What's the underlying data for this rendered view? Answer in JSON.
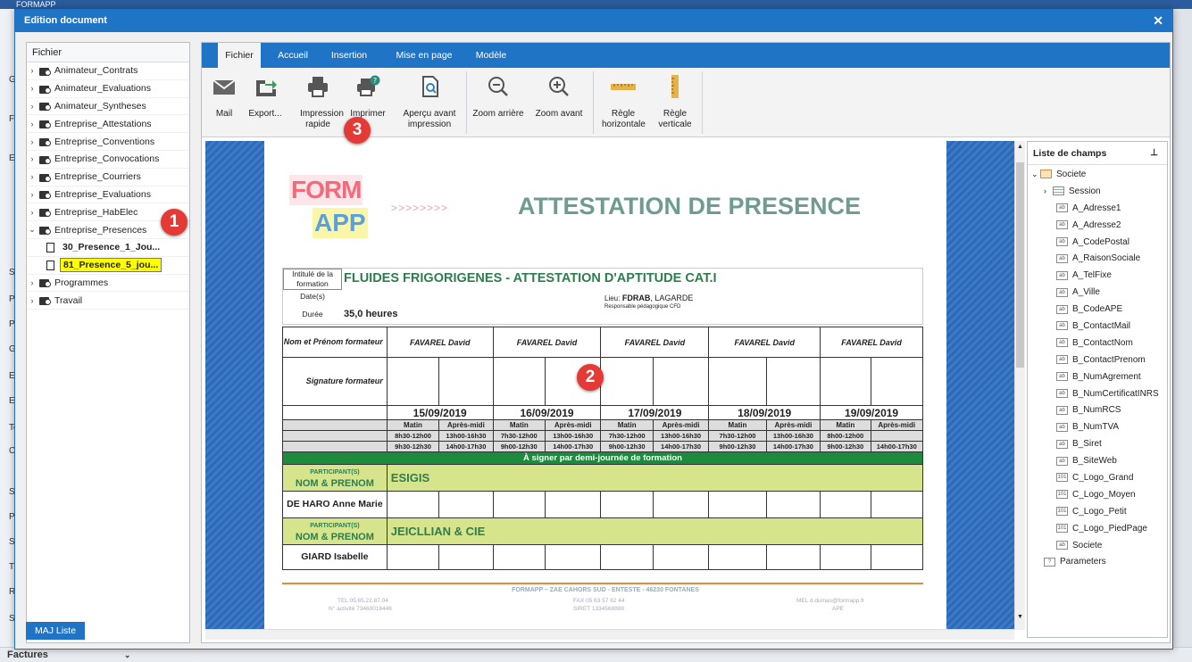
{
  "app": {
    "title": "FORMAPP"
  },
  "background": {
    "left_labels": [
      "G",
      "Fo",
      "Ex",
      "S",
      "Pa",
      "Pr",
      "G",
      "Ex",
      "Ex",
      "Te",
      "C",
      "S",
      "Pl",
      "SY",
      "Ti",
      "R",
      "Sc"
    ],
    "bottom_label": "Factures"
  },
  "window": {
    "title": "Edition document"
  },
  "tree": {
    "header": "Fichier",
    "folders": [
      "Animateur_Contrats",
      "Animateur_Evaluations",
      "Animateur_Syntheses",
      "Entreprise_Attestations",
      "Entreprise_Conventions",
      "Entreprise_Convocations",
      "Entreprise_Courriers",
      "Entreprise_Evaluations",
      "Entreprise_HabElec",
      "Entreprise_Presences"
    ],
    "docs": [
      "30_Presence_1_Jou...",
      "81_Presence_5_jou..."
    ],
    "folders2": [
      "Programmes",
      "Travail"
    ],
    "maj_button": "MAJ Liste"
  },
  "tabs": [
    "Fichier",
    "Accueil",
    "Insertion",
    "Mise en page",
    "Modèle"
  ],
  "ribbon": {
    "mail": "Mail",
    "export": "Export...",
    "quick_print": "Impression rapide",
    "print": "Imprimer",
    "preview": "Aperçu avant impression",
    "zoom_out": "Zoom arrière",
    "zoom_in": "Zoom avant",
    "h_ruler": "Règle horizontale",
    "v_ruler": "Règle verticale"
  },
  "badges": {
    "b1": "1",
    "b2": "2",
    "b3": "3"
  },
  "document": {
    "logo_top": "FORM",
    "logo_bottom": "APP",
    "arrows": ">>>>>>>>",
    "title": "ATTESTATION DE PRESENCE",
    "lbl_intitule": "Intitulé de la formation",
    "formation": "FLUIDES FRIGORIGENES - ATTESTATION D'APTITUDE CAT.I",
    "lbl_dates": "Date(s)",
    "lieu_label": "Lieu:",
    "lieu": "FDRAB",
    "lieu_city": ", LAGARDE",
    "responsable": "Responsable pédagogique CFD",
    "lbl_duree": "Durée",
    "duree": "35,0 heures",
    "lbl_nom_formateur": "Nom et Prénom formateur",
    "formateur": "FAVAREL David",
    "lbl_signature": "Signature formateur",
    "dates": [
      "15/09/2019",
      "16/09/2019",
      "17/09/2019",
      "18/09/2019",
      "19/09/2019"
    ],
    "matin": "Matin",
    "aprem": "Après-midi",
    "h1": [
      "8h30-12h00",
      "13h00-16h30",
      "7h30-12h00",
      "13h00-16h30",
      "7h30-12h00",
      "13h00-16h30",
      "7h30-12h00",
      "13h00-16h30",
      "8h00-12h00",
      ""
    ],
    "h2": [
      "9h30-12h30",
      "14h00-17h30",
      "9h00-12h30",
      "14h00-17h30",
      "9h00-12h30",
      "14h00-17h30",
      "9h00-12h30",
      "14h00-17h30",
      "9h00-12h30",
      "14h00-17h30"
    ],
    "signer": "À signer par demi-journée de formation",
    "participants_lbl": "PARTICIPANT(S)",
    "nom_prenom_lbl": "NOM & PRENOM",
    "company1": "ESIGIS",
    "person1": "DE HARO Anne Marie",
    "company2": "JEICLLIAN & CIE",
    "person2": "GIARD Isabelle",
    "footer_company": "FORMAPP – ZAE CAHORS SUD - ENTESTE - 46230 FONTANES",
    "footer_tel": "TEL 05.65.22.87.04",
    "footer_activity": "N° activité 73460016446",
    "footer_fax": "FAX 05 63 57 62 44",
    "footer_siret": "SIRET 1334568888",
    "footer_mail": "MEL d.dumas@formapp.fr",
    "footer_ape": "APE"
  },
  "fields": {
    "header": "Liste de champs",
    "root": "Societe",
    "session": "Session",
    "items": [
      {
        "label": "A_Adresse1",
        "type": "ab"
      },
      {
        "label": "A_Adresse2",
        "type": "ab"
      },
      {
        "label": "A_CodePostal",
        "type": "ab"
      },
      {
        "label": "A_RaisonSociale",
        "type": "ab"
      },
      {
        "label": "A_TelFixe",
        "type": "ab"
      },
      {
        "label": "A_Ville",
        "type": "ab"
      },
      {
        "label": "B_CodeAPE",
        "type": "ab"
      },
      {
        "label": "B_ContactMail",
        "type": "ab"
      },
      {
        "label": "B_ContactNom",
        "type": "ab"
      },
      {
        "label": "B_ContactPrenom",
        "type": "ab"
      },
      {
        "label": "B_NumAgrement",
        "type": "ab"
      },
      {
        "label": "B_NumCertificatINRS",
        "type": "ab"
      },
      {
        "label": "B_NumRCS",
        "type": "ab"
      },
      {
        "label": "B_NumTVA",
        "type": "ab"
      },
      {
        "label": "B_Siret",
        "type": "ab"
      },
      {
        "label": "B_SiteWeb",
        "type": "ab"
      },
      {
        "label": "C_Logo_Grand",
        "type": "101"
      },
      {
        "label": "C_Logo_Moyen",
        "type": "101"
      },
      {
        "label": "C_Logo_Petit",
        "type": "101"
      },
      {
        "label": "C_Logo_PiedPage",
        "type": "101"
      },
      {
        "label": "Societe",
        "type": "ab"
      }
    ],
    "params": "Parameters"
  }
}
